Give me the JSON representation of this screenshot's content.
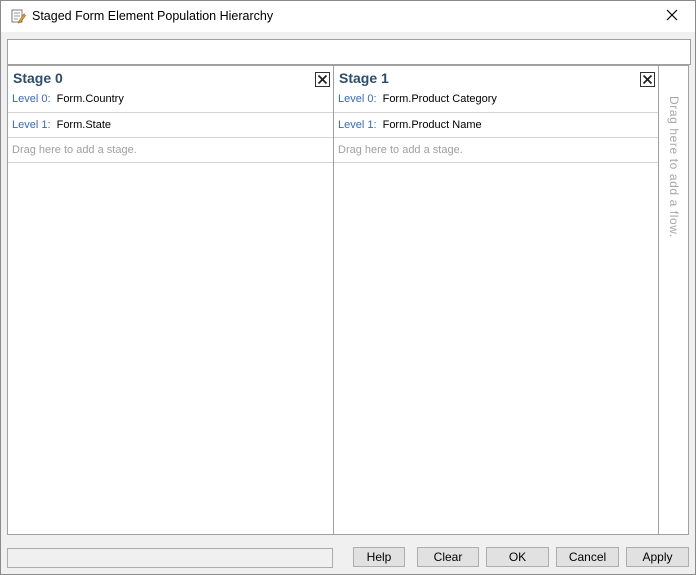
{
  "window": {
    "title": "Staged Form Element Population Hierarchy"
  },
  "stages": [
    {
      "title": "Stage 0",
      "levels": [
        {
          "label": "Level 0:",
          "value": "Form.Country"
        },
        {
          "label": "Level 1:",
          "value": "Form.State"
        }
      ],
      "drag_hint": "Drag here to add a stage."
    },
    {
      "title": "Stage 1",
      "levels": [
        {
          "label": "Level 0:",
          "value": "Form.Product Category"
        },
        {
          "label": "Level 1:",
          "value": "Form.Product Name"
        }
      ],
      "drag_hint": "Drag here to add a stage."
    }
  ],
  "flow_hint": "Drag here to add a flow.",
  "buttons": {
    "help": "Help",
    "clear": "Clear",
    "ok": "OK",
    "cancel": "Cancel",
    "apply": "Apply"
  },
  "icons": {
    "app": "form-edit-icon",
    "close": "close-icon",
    "stage_close": "stage-close-icon"
  }
}
